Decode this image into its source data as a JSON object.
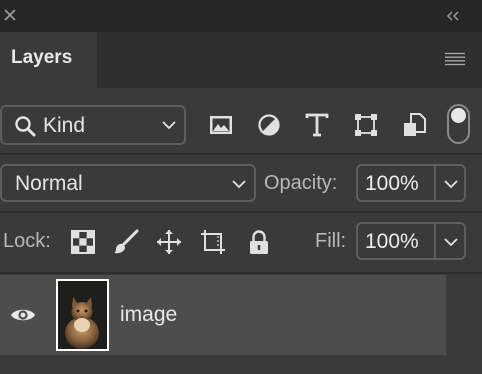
{
  "window": {
    "close_icon": "close-icon",
    "collapse_icon": "double-chevron-left-icon"
  },
  "tab": {
    "label": "Layers",
    "menu_icon": "panel-menu-icon"
  },
  "filter": {
    "kind_label": "Kind",
    "icons": [
      "image-filter-icon",
      "adjustment-filter-icon",
      "type-filter-icon",
      "shape-filter-icon",
      "smart-object-filter-icon"
    ],
    "toggle_on": true
  },
  "blend": {
    "mode": "Normal",
    "opacity_label": "Opacity:",
    "opacity_value": "100%"
  },
  "lock": {
    "label": "Lock:",
    "icons": [
      "lock-transparent-pixels-icon",
      "lock-image-pixels-icon",
      "lock-position-icon",
      "lock-artboard-icon",
      "lock-all-icon"
    ],
    "fill_label": "Fill:",
    "fill_value": "100%"
  },
  "layers": [
    {
      "name": "image",
      "visible": true,
      "thumbnail": "cat-photo"
    }
  ],
  "colors": {
    "panel": "#3a3a3a",
    "selected_row": "#4d4d4d",
    "text": "#e8e8e8",
    "border": "#5e5e5e"
  }
}
